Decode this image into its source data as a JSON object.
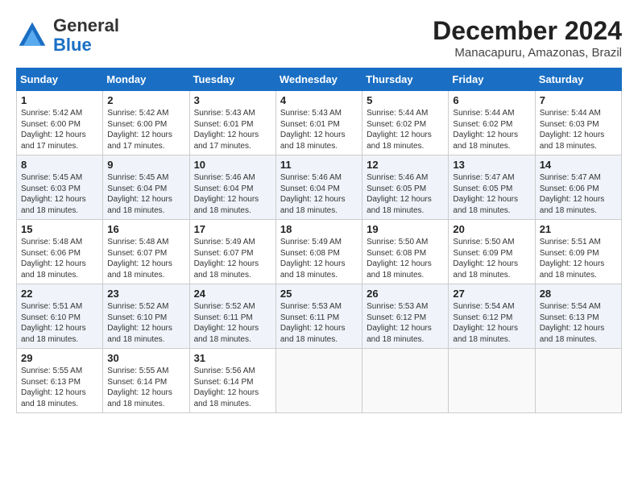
{
  "logo": {
    "general": "General",
    "blue": "Blue"
  },
  "header": {
    "month": "December 2024",
    "location": "Manacapuru, Amazonas, Brazil"
  },
  "weekdays": [
    "Sunday",
    "Monday",
    "Tuesday",
    "Wednesday",
    "Thursday",
    "Friday",
    "Saturday"
  ],
  "weeks": [
    [
      {
        "day": 1,
        "sunrise": "5:42 AM",
        "sunset": "6:00 PM",
        "daylight": "12 hours and 17 minutes"
      },
      {
        "day": 2,
        "sunrise": "5:42 AM",
        "sunset": "6:00 PM",
        "daylight": "12 hours and 17 minutes"
      },
      {
        "day": 3,
        "sunrise": "5:43 AM",
        "sunset": "6:01 PM",
        "daylight": "12 hours and 17 minutes"
      },
      {
        "day": 4,
        "sunrise": "5:43 AM",
        "sunset": "6:01 PM",
        "daylight": "12 hours and 18 minutes"
      },
      {
        "day": 5,
        "sunrise": "5:44 AM",
        "sunset": "6:02 PM",
        "daylight": "12 hours and 18 minutes"
      },
      {
        "day": 6,
        "sunrise": "5:44 AM",
        "sunset": "6:02 PM",
        "daylight": "12 hours and 18 minutes"
      },
      {
        "day": 7,
        "sunrise": "5:44 AM",
        "sunset": "6:03 PM",
        "daylight": "12 hours and 18 minutes"
      }
    ],
    [
      {
        "day": 8,
        "sunrise": "5:45 AM",
        "sunset": "6:03 PM",
        "daylight": "12 hours and 18 minutes"
      },
      {
        "day": 9,
        "sunrise": "5:45 AM",
        "sunset": "6:04 PM",
        "daylight": "12 hours and 18 minutes"
      },
      {
        "day": 10,
        "sunrise": "5:46 AM",
        "sunset": "6:04 PM",
        "daylight": "12 hours and 18 minutes"
      },
      {
        "day": 11,
        "sunrise": "5:46 AM",
        "sunset": "6:04 PM",
        "daylight": "12 hours and 18 minutes"
      },
      {
        "day": 12,
        "sunrise": "5:46 AM",
        "sunset": "6:05 PM",
        "daylight": "12 hours and 18 minutes"
      },
      {
        "day": 13,
        "sunrise": "5:47 AM",
        "sunset": "6:05 PM",
        "daylight": "12 hours and 18 minutes"
      },
      {
        "day": 14,
        "sunrise": "5:47 AM",
        "sunset": "6:06 PM",
        "daylight": "12 hours and 18 minutes"
      }
    ],
    [
      {
        "day": 15,
        "sunrise": "5:48 AM",
        "sunset": "6:06 PM",
        "daylight": "12 hours and 18 minutes"
      },
      {
        "day": 16,
        "sunrise": "5:48 AM",
        "sunset": "6:07 PM",
        "daylight": "12 hours and 18 minutes"
      },
      {
        "day": 17,
        "sunrise": "5:49 AM",
        "sunset": "6:07 PM",
        "daylight": "12 hours and 18 minutes"
      },
      {
        "day": 18,
        "sunrise": "5:49 AM",
        "sunset": "6:08 PM",
        "daylight": "12 hours and 18 minutes"
      },
      {
        "day": 19,
        "sunrise": "5:50 AM",
        "sunset": "6:08 PM",
        "daylight": "12 hours and 18 minutes"
      },
      {
        "day": 20,
        "sunrise": "5:50 AM",
        "sunset": "6:09 PM",
        "daylight": "12 hours and 18 minutes"
      },
      {
        "day": 21,
        "sunrise": "5:51 AM",
        "sunset": "6:09 PM",
        "daylight": "12 hours and 18 minutes"
      }
    ],
    [
      {
        "day": 22,
        "sunrise": "5:51 AM",
        "sunset": "6:10 PM",
        "daylight": "12 hours and 18 minutes"
      },
      {
        "day": 23,
        "sunrise": "5:52 AM",
        "sunset": "6:10 PM",
        "daylight": "12 hours and 18 minutes"
      },
      {
        "day": 24,
        "sunrise": "5:52 AM",
        "sunset": "6:11 PM",
        "daylight": "12 hours and 18 minutes"
      },
      {
        "day": 25,
        "sunrise": "5:53 AM",
        "sunset": "6:11 PM",
        "daylight": "12 hours and 18 minutes"
      },
      {
        "day": 26,
        "sunrise": "5:53 AM",
        "sunset": "6:12 PM",
        "daylight": "12 hours and 18 minutes"
      },
      {
        "day": 27,
        "sunrise": "5:54 AM",
        "sunset": "6:12 PM",
        "daylight": "12 hours and 18 minutes"
      },
      {
        "day": 28,
        "sunrise": "5:54 AM",
        "sunset": "6:13 PM",
        "daylight": "12 hours and 18 minutes"
      }
    ],
    [
      {
        "day": 29,
        "sunrise": "5:55 AM",
        "sunset": "6:13 PM",
        "daylight": "12 hours and 18 minutes"
      },
      {
        "day": 30,
        "sunrise": "5:55 AM",
        "sunset": "6:14 PM",
        "daylight": "12 hours and 18 minutes"
      },
      {
        "day": 31,
        "sunrise": "5:56 AM",
        "sunset": "6:14 PM",
        "daylight": "12 hours and 18 minutes"
      },
      null,
      null,
      null,
      null
    ]
  ]
}
